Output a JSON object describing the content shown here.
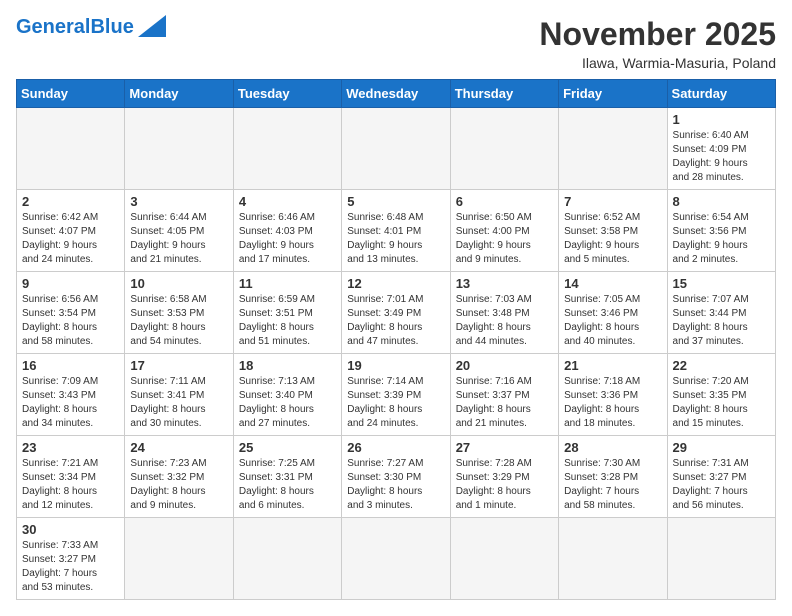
{
  "header": {
    "logo_general": "General",
    "logo_blue": "Blue",
    "month_title": "November 2025",
    "subtitle": "Ilawa, Warmia-Masuria, Poland"
  },
  "weekdays": [
    "Sunday",
    "Monday",
    "Tuesday",
    "Wednesday",
    "Thursday",
    "Friday",
    "Saturday"
  ],
  "weeks": [
    [
      {
        "day": "",
        "info": ""
      },
      {
        "day": "",
        "info": ""
      },
      {
        "day": "",
        "info": ""
      },
      {
        "day": "",
        "info": ""
      },
      {
        "day": "",
        "info": ""
      },
      {
        "day": "",
        "info": ""
      },
      {
        "day": "1",
        "info": "Sunrise: 6:40 AM\nSunset: 4:09 PM\nDaylight: 9 hours\nand 28 minutes."
      }
    ],
    [
      {
        "day": "2",
        "info": "Sunrise: 6:42 AM\nSunset: 4:07 PM\nDaylight: 9 hours\nand 24 minutes."
      },
      {
        "day": "3",
        "info": "Sunrise: 6:44 AM\nSunset: 4:05 PM\nDaylight: 9 hours\nand 21 minutes."
      },
      {
        "day": "4",
        "info": "Sunrise: 6:46 AM\nSunset: 4:03 PM\nDaylight: 9 hours\nand 17 minutes."
      },
      {
        "day": "5",
        "info": "Sunrise: 6:48 AM\nSunset: 4:01 PM\nDaylight: 9 hours\nand 13 minutes."
      },
      {
        "day": "6",
        "info": "Sunrise: 6:50 AM\nSunset: 4:00 PM\nDaylight: 9 hours\nand 9 minutes."
      },
      {
        "day": "7",
        "info": "Sunrise: 6:52 AM\nSunset: 3:58 PM\nDaylight: 9 hours\nand 5 minutes."
      },
      {
        "day": "8",
        "info": "Sunrise: 6:54 AM\nSunset: 3:56 PM\nDaylight: 9 hours\nand 2 minutes."
      }
    ],
    [
      {
        "day": "9",
        "info": "Sunrise: 6:56 AM\nSunset: 3:54 PM\nDaylight: 8 hours\nand 58 minutes."
      },
      {
        "day": "10",
        "info": "Sunrise: 6:58 AM\nSunset: 3:53 PM\nDaylight: 8 hours\nand 54 minutes."
      },
      {
        "day": "11",
        "info": "Sunrise: 6:59 AM\nSunset: 3:51 PM\nDaylight: 8 hours\nand 51 minutes."
      },
      {
        "day": "12",
        "info": "Sunrise: 7:01 AM\nSunset: 3:49 PM\nDaylight: 8 hours\nand 47 minutes."
      },
      {
        "day": "13",
        "info": "Sunrise: 7:03 AM\nSunset: 3:48 PM\nDaylight: 8 hours\nand 44 minutes."
      },
      {
        "day": "14",
        "info": "Sunrise: 7:05 AM\nSunset: 3:46 PM\nDaylight: 8 hours\nand 40 minutes."
      },
      {
        "day": "15",
        "info": "Sunrise: 7:07 AM\nSunset: 3:44 PM\nDaylight: 8 hours\nand 37 minutes."
      }
    ],
    [
      {
        "day": "16",
        "info": "Sunrise: 7:09 AM\nSunset: 3:43 PM\nDaylight: 8 hours\nand 34 minutes."
      },
      {
        "day": "17",
        "info": "Sunrise: 7:11 AM\nSunset: 3:41 PM\nDaylight: 8 hours\nand 30 minutes."
      },
      {
        "day": "18",
        "info": "Sunrise: 7:13 AM\nSunset: 3:40 PM\nDaylight: 8 hours\nand 27 minutes."
      },
      {
        "day": "19",
        "info": "Sunrise: 7:14 AM\nSunset: 3:39 PM\nDaylight: 8 hours\nand 24 minutes."
      },
      {
        "day": "20",
        "info": "Sunrise: 7:16 AM\nSunset: 3:37 PM\nDaylight: 8 hours\nand 21 minutes."
      },
      {
        "day": "21",
        "info": "Sunrise: 7:18 AM\nSunset: 3:36 PM\nDaylight: 8 hours\nand 18 minutes."
      },
      {
        "day": "22",
        "info": "Sunrise: 7:20 AM\nSunset: 3:35 PM\nDaylight: 8 hours\nand 15 minutes."
      }
    ],
    [
      {
        "day": "23",
        "info": "Sunrise: 7:21 AM\nSunset: 3:34 PM\nDaylight: 8 hours\nand 12 minutes."
      },
      {
        "day": "24",
        "info": "Sunrise: 7:23 AM\nSunset: 3:32 PM\nDaylight: 8 hours\nand 9 minutes."
      },
      {
        "day": "25",
        "info": "Sunrise: 7:25 AM\nSunset: 3:31 PM\nDaylight: 8 hours\nand 6 minutes."
      },
      {
        "day": "26",
        "info": "Sunrise: 7:27 AM\nSunset: 3:30 PM\nDaylight: 8 hours\nand 3 minutes."
      },
      {
        "day": "27",
        "info": "Sunrise: 7:28 AM\nSunset: 3:29 PM\nDaylight: 8 hours\nand 1 minute."
      },
      {
        "day": "28",
        "info": "Sunrise: 7:30 AM\nSunset: 3:28 PM\nDaylight: 7 hours\nand 58 minutes."
      },
      {
        "day": "29",
        "info": "Sunrise: 7:31 AM\nSunset: 3:27 PM\nDaylight: 7 hours\nand 56 minutes."
      }
    ],
    [
      {
        "day": "30",
        "info": "Sunrise: 7:33 AM\nSunset: 3:27 PM\nDaylight: 7 hours\nand 53 minutes."
      },
      {
        "day": "",
        "info": ""
      },
      {
        "day": "",
        "info": ""
      },
      {
        "day": "",
        "info": ""
      },
      {
        "day": "",
        "info": ""
      },
      {
        "day": "",
        "info": ""
      },
      {
        "day": "",
        "info": ""
      }
    ]
  ]
}
